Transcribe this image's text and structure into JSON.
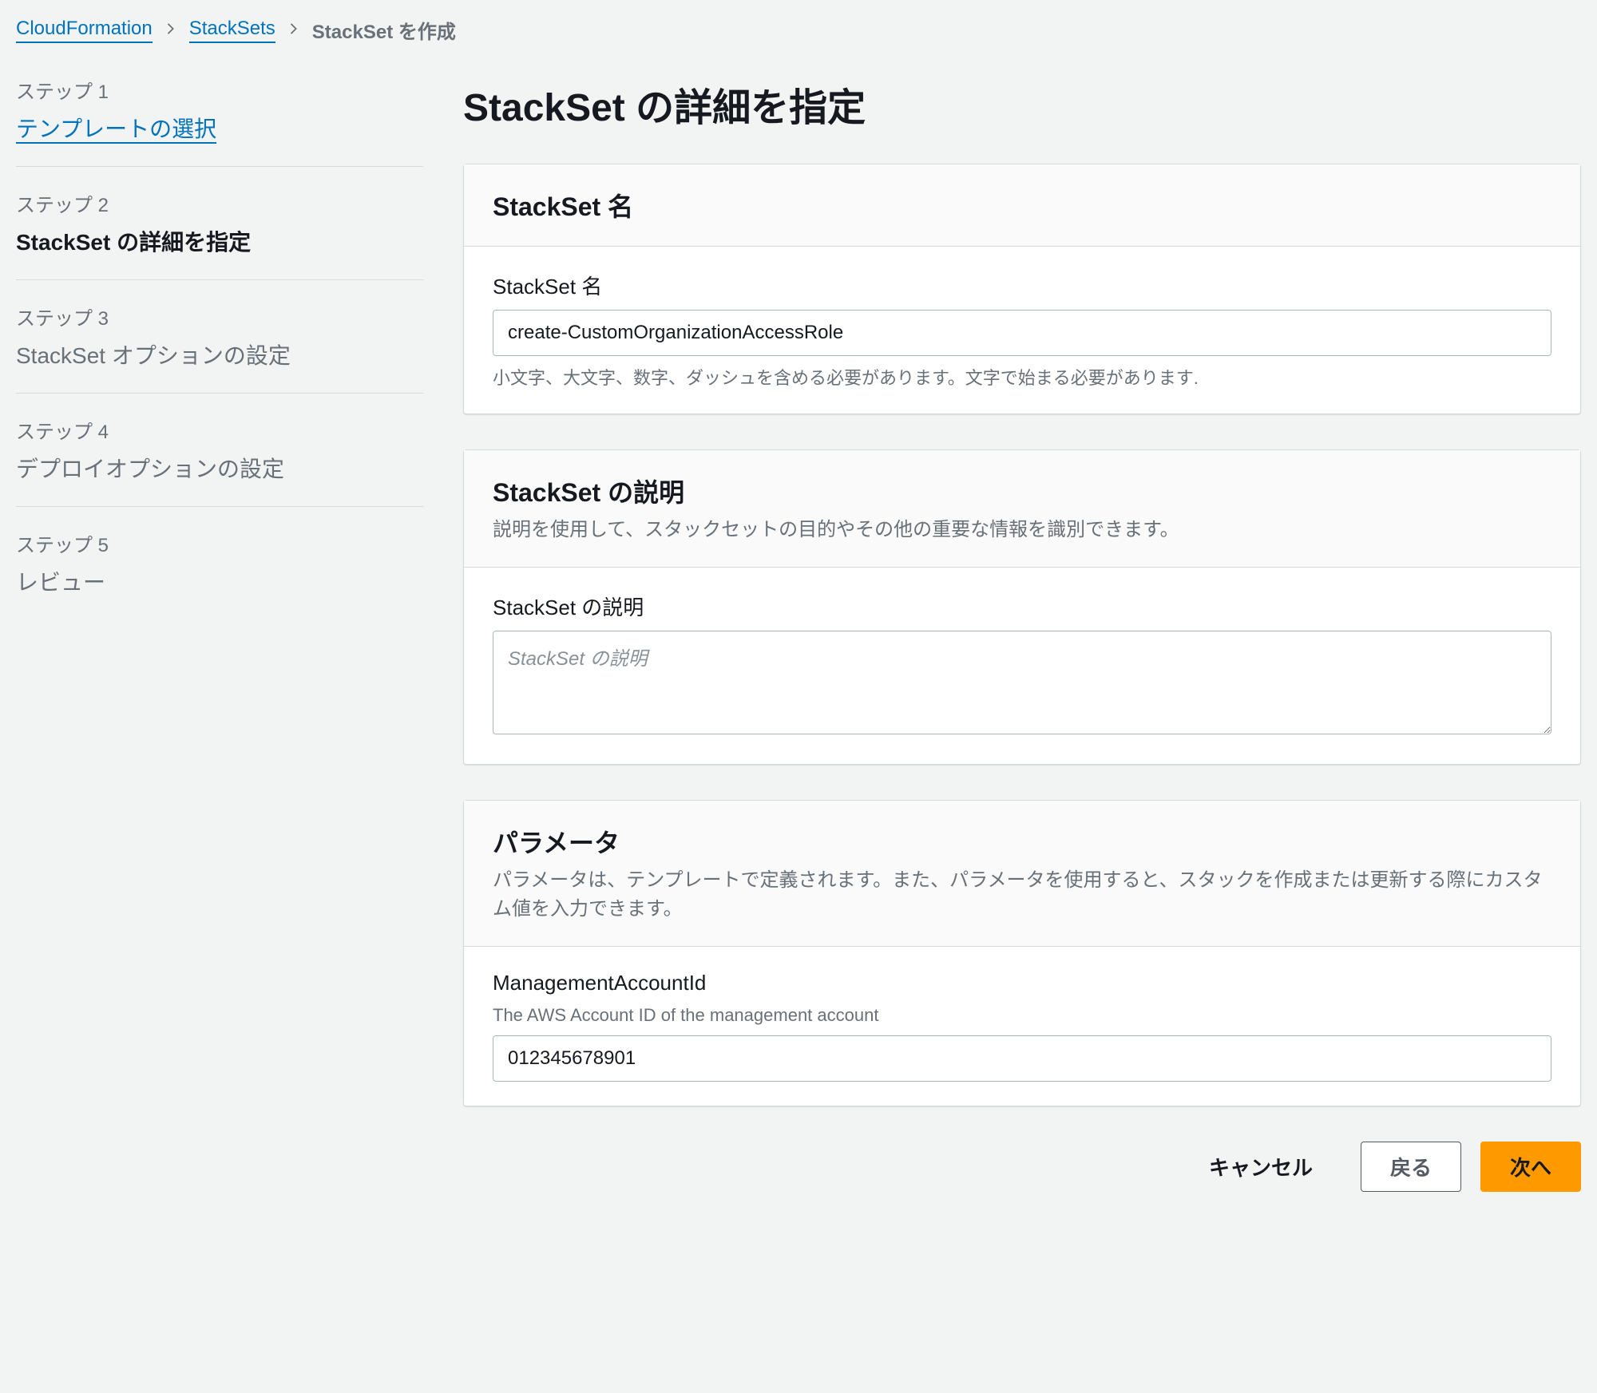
{
  "breadcrumb": {
    "root": "CloudFormation",
    "mid": "StackSets",
    "current": "StackSet を作成"
  },
  "page": {
    "title": "StackSet の詳細を指定"
  },
  "sidebar": {
    "steps": [
      {
        "num": "ステップ 1",
        "title": "テンプレートの選択"
      },
      {
        "num": "ステップ 2",
        "title": "StackSet の詳細を指定"
      },
      {
        "num": "ステップ 3",
        "title": "StackSet オプションの設定"
      },
      {
        "num": "ステップ 4",
        "title": "デプロイオプションの設定"
      },
      {
        "num": "ステップ 5",
        "title": "レビュー"
      }
    ]
  },
  "panels": {
    "name": {
      "title": "StackSet 名",
      "field_label": "StackSet 名",
      "value": "create-CustomOrganizationAccessRole",
      "hint": "小文字、大文字、数字、ダッシュを含める必要があります。文字で始まる必要があります."
    },
    "description": {
      "title": "StackSet の説明",
      "subtitle": "説明を使用して、スタックセットの目的やその他の重要な情報を識別できます。",
      "field_label": "StackSet の説明",
      "placeholder": "StackSet の説明",
      "value": ""
    },
    "parameters": {
      "title": "パラメータ",
      "subtitle": "パラメータは、テンプレートで定義されます。また、パラメータを使用すると、スタックを作成または更新する際にカスタム値を入力できます。",
      "items": [
        {
          "name": "ManagementAccountId",
          "description": "The AWS Account ID of the management account",
          "value": "012345678901"
        }
      ]
    }
  },
  "footer": {
    "cancel": "キャンセル",
    "back": "戻る",
    "next": "次へ"
  }
}
